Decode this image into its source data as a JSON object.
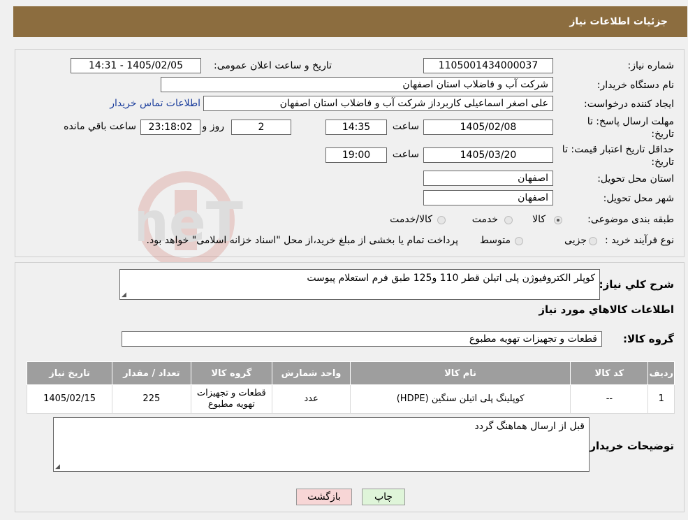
{
  "header": {
    "title": "جزئیات اطلاعات نیاز"
  },
  "fields": {
    "need_number": {
      "label": "شماره نیاز:",
      "value": "1105001434000037"
    },
    "announce_datetime": {
      "label": "تاریخ و ساعت اعلان عمومی:",
      "value": "1405/02/05 - 14:31"
    },
    "buyer_org": {
      "label": "نام دستگاه خریدار:",
      "value": "شرکت آب و فاضلاب استان اصفهان"
    },
    "requester": {
      "label": "ایجاد کننده درخواست:",
      "value": "علی اصغر اسماعیلی کاربرداز شرکت آب و فاضلاب استان اصفهان",
      "contact_link": "اطلاعات تماس خریدار"
    },
    "reply_deadline": {
      "label_line1": "مهلت ارسال پاسخ: تا",
      "label_line2": "تاریخ:",
      "date": "1405/02/08",
      "time_label": "ساعت",
      "time": "14:35",
      "days": "2",
      "days_label": "روز و",
      "remaining": "23:18:02",
      "remaining_label": "ساعت باقي مانده"
    },
    "price_validity": {
      "label_line1": "حداقل تاریخ اعتبار قیمت: تا",
      "label_line2": "تاریخ:",
      "date": "1405/03/20",
      "time_label": "ساعت",
      "time": "19:00"
    },
    "delivery_province": {
      "label": "استان محل تحویل:",
      "value": "اصفهان"
    },
    "delivery_city": {
      "label": "شهر محل تحویل:",
      "value": "اصفهان"
    },
    "category": {
      "label": "طبقه بندی موضوعی:",
      "options": [
        "کالا",
        "خدمت",
        "کالا/خدمت"
      ],
      "selected": "کالا"
    },
    "purchase_process": {
      "label": "نوع فرآیند خرید :",
      "options": [
        "جزیی",
        "متوسط"
      ],
      "note": "پرداخت تمام یا بخشی از مبلغ خرید،از محل \"اسناد خزانه اسلامی\" خواهد بود."
    }
  },
  "description": {
    "label": "شرح کلي نياز:",
    "value": "کوپلر الکتروفیوژن پلی اتیلن قطر 110 و125 طبق فرم استعلام پیوست"
  },
  "items_section": {
    "title": "اطلاعات کالاهاي مورد نياز",
    "group_label": "گروه کالا:",
    "group_value": "قطعات و تجهیزات تهویه مطبوع"
  },
  "table": {
    "headers": [
      "ردیف",
      "کد کالا",
      "نام کالا",
      "واحد شمارش",
      "گروه کالا",
      "تعداد / مقدار",
      "تاریخ نیاز"
    ],
    "rows": [
      [
        "1",
        "--",
        "کوپلینگ پلی اتیلن سنگین (HDPE)",
        "عدد",
        "قطعات و تجهیزات تهویه مطبوع",
        "225",
        "1405/02/15"
      ]
    ]
  },
  "buyer_notes": {
    "label": "توضیحات خریدار:",
    "value": "قبل از ارسال هماهنگ گردد"
  },
  "buttons": {
    "print": "چاپ",
    "back": "بازگشت"
  },
  "watermark_text": "AriaTender.neT",
  "colors": {
    "header": "#8c6d3f",
    "table_header": "#9e9e9e",
    "link": "#1a3d9c",
    "back_button": "#f7d6d6",
    "print_button": "#dff5d9"
  }
}
